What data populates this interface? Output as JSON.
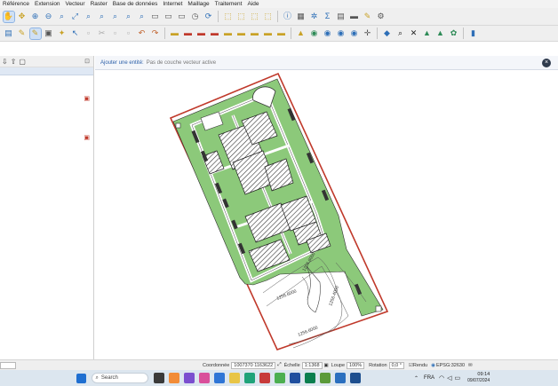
{
  "menu": [
    "Référence",
    "Extension",
    "Vecteur",
    "Raster",
    "Base de données",
    "Internet",
    "Maillage",
    "Traitement",
    "Aide"
  ],
  "info_bar": {
    "title": "Ajouter une entité:",
    "hint": "Pas de couche vecteur active"
  },
  "labels": {
    "contour1": "1256.6000",
    "contour2": "1256.6000",
    "contour3": "1256.4000",
    "contour4": "1256.6000"
  },
  "status": {
    "coord_label": "Coordonnée",
    "coord_value": "1007370 1163622",
    "scale_label": "Échelle",
    "scale_value": "1:1368",
    "magnifier_label": "Loupe",
    "magnifier_value": "100%",
    "rotation_label": "Rotation",
    "rotation_value": "0,0 °",
    "render_label": "Rendu",
    "crs_value": "EPSG:32630"
  },
  "taskbar": {
    "search": "Search",
    "lang": "FRA",
    "time": "09:14",
    "date": "09/07/2024"
  }
}
